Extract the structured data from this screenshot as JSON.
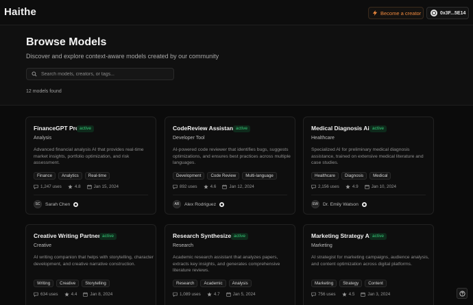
{
  "header": {
    "brand": "Haithe",
    "creator_button": "Become a creator",
    "wallet_address": "0x3F...5E14"
  },
  "hero": {
    "title": "Browse Models",
    "subtitle": "Discover and explore context-aware models created by our community",
    "search_placeholder": "Search models, creators, or tags...",
    "results_count": "12 models found"
  },
  "colors": {
    "accent_orange": "#f08a3e",
    "status_green": "#36c977",
    "background": "#0b0b0b"
  },
  "cards": [
    {
      "name": "FinanceGPT Pro",
      "status": "active",
      "category": "Analysis",
      "description": "Advanced financial analysis AI that provides real-time market insights, portfolio optimization, and risk assessment.",
      "tags": [
        "Finance",
        "Analytics",
        "Real-time"
      ],
      "uses": "1,247 uses",
      "rating": "4.8",
      "date": "Jan 15, 2024",
      "author_initials": "SC",
      "author": "Sarah Chen"
    },
    {
      "name": "CodeReview Assistant",
      "status": "active",
      "category": "Developer Tool",
      "description": "AI-powered code reviewer that identifies bugs, suggests optimizations, and ensures best practices across multiple languages.",
      "tags": [
        "Development",
        "Code Review",
        "Multi-language"
      ],
      "uses": "892 uses",
      "rating": "4.6",
      "date": "Jan 12, 2024",
      "author_initials": "AR",
      "author": "Alex Rodriguez"
    },
    {
      "name": "Medical Diagnosis Aid",
      "status": "active",
      "category": "Healthcare",
      "description": "Specialized AI for preliminary medical diagnosis assistance, trained on extensive medical literature and case studies.",
      "tags": [
        "Healthcare",
        "Diagnosis",
        "Medical"
      ],
      "uses": "2,156 uses",
      "rating": "4.9",
      "date": "Jan 10, 2024",
      "author_initials": "EW",
      "author": "Dr. Emily Watson"
    },
    {
      "name": "Creative Writing Partner",
      "status": "active",
      "category": "Creative",
      "description": "AI writing companion that helps with storytelling, character development, and creative narrative construction.",
      "tags": [
        "Writing",
        "Creative",
        "Storytelling"
      ],
      "uses": "634 uses",
      "rating": "4.4",
      "date": "Jan 8, 2024"
    },
    {
      "name": "Research Synthesizer",
      "status": "active",
      "category": "Research",
      "description": "Academic research assistant that analyzes papers, extracts key insights, and generates comprehensive literature reviews.",
      "tags": [
        "Research",
        "Academic",
        "Analysis"
      ],
      "uses": "1,089 uses",
      "rating": "4.7",
      "date": "Jan 5, 2024"
    },
    {
      "name": "Marketing Strategy AI",
      "status": "active",
      "category": "Marketing",
      "description": "AI strategist for marketing campaigns, audience analysis, and content optimization across digital platforms.",
      "tags": [
        "Marketing",
        "Strategy",
        "Content"
      ],
      "uses": "756 uses",
      "rating": "4.5",
      "date": "Jan 3, 2024"
    }
  ]
}
